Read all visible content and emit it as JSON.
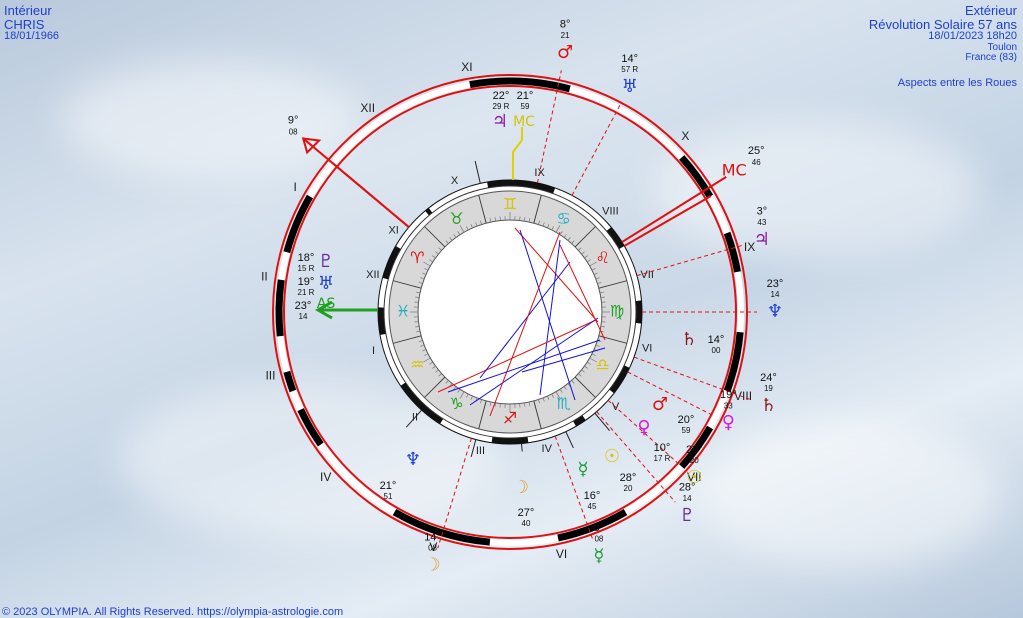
{
  "header_left": {
    "line1": "Intérieur",
    "line2": "CHRIS",
    "line3": "18/01/1966"
  },
  "header_right": {
    "line1": "Extérieur",
    "line2": "Révolution Solaire 57 ans",
    "line3": "18/01/2023 18h20",
    "line4": "Toulon",
    "line5": "France (83)"
  },
  "aspects_link": "Aspects entre les Roues",
  "footer": "© 2023 OLYMPIA. All Rights Reserved. https://olympia-astrologie.com",
  "colors": {
    "text": "#1f3fd0",
    "red": "#e01010",
    "blue": "#1010e0"
  },
  "outer_houses": [
    "XI",
    "XII",
    "I",
    "II",
    "III",
    "IV",
    "V",
    "VI",
    "VII",
    "VIII",
    "IX",
    "X"
  ],
  "inner_houses": [
    "X",
    "XI",
    "XII",
    "I",
    "II",
    "III",
    "IV",
    "V",
    "VI",
    "VII",
    "VIII",
    "IX"
  ],
  "outer_planets": [
    {
      "glyph": "♂",
      "deg": "8°",
      "min": "21",
      "color": "#e01010"
    },
    {
      "glyph": "♅",
      "deg": "14°",
      "min": "57 R",
      "color": "#1f3fd0"
    },
    {
      "glyph": "♃",
      "deg": "3°",
      "min": "43",
      "color": "#8a1aa8"
    },
    {
      "glyph": "♆",
      "deg": "23°",
      "min": "14",
      "color": "#1f3fd0"
    },
    {
      "glyph": "♄",
      "deg": "24°",
      "min": "19",
      "color": "#8a1a1a"
    },
    {
      "glyph": "♀",
      "deg": "19°",
      "min": "33",
      "color": "#d61ad6"
    },
    {
      "glyph": "☉",
      "deg": "28°",
      "min": "20",
      "color": "#d6c400"
    },
    {
      "glyph": "♇",
      "deg": "28°",
      "min": "14",
      "color": "#6a2a9a"
    },
    {
      "glyph": "☿",
      "deg": "8°",
      "min": "08",
      "color": "#1a9a3a"
    },
    {
      "glyph": "☽",
      "deg": "14°",
      "min": "08",
      "color": "#e0a030"
    }
  ],
  "outer_angles": [
    {
      "name": "AS",
      "deg": "9°",
      "min": "08"
    },
    {
      "name": "MC",
      "deg": "25°",
      "min": "46"
    }
  ],
  "inner_planets": [
    {
      "glyph": "♃",
      "deg": "22°",
      "min": "29 R",
      "color": "#8a1aa8"
    },
    {
      "glyph": "MC",
      "deg": "21°",
      "min": "59",
      "color": "#d6c400"
    },
    {
      "glyph": "♇",
      "deg": "18°",
      "min": "15 R",
      "color": "#6a2a9a"
    },
    {
      "glyph": "♅",
      "deg": "19°",
      "min": "21 R",
      "color": "#1f3fd0"
    },
    {
      "glyph": "AS",
      "deg": "23°",
      "min": "14",
      "color": "#20a020"
    },
    {
      "glyph": "♄",
      "deg": "14°",
      "min": "00",
      "color": "#8a1a1a"
    },
    {
      "glyph": "♂",
      "deg": "20°",
      "min": "59",
      "color": "#e01010"
    },
    {
      "glyph": "♀",
      "deg": "10°",
      "min": "17 R",
      "color": "#d61ad6"
    },
    {
      "glyph": "☉",
      "deg": "28°",
      "min": "20",
      "color": "#d6c400"
    },
    {
      "glyph": "☿",
      "deg": "16°",
      "min": "45",
      "color": "#1a9a3a"
    },
    {
      "glyph": "☽",
      "deg": "27°",
      "min": "40",
      "color": "#e0a030"
    },
    {
      "glyph": "♆",
      "deg": "21°",
      "min": "51",
      "color": "#1f3fd0"
    }
  ],
  "zodiac": [
    {
      "glyph": "♊",
      "color": "#d6c400"
    },
    {
      "glyph": "♋",
      "color": "#20b0c0"
    },
    {
      "glyph": "♌",
      "color": "#e01010"
    },
    {
      "glyph": "♍",
      "color": "#20a020"
    },
    {
      "glyph": "♎",
      "color": "#d6c400"
    },
    {
      "glyph": "♏",
      "color": "#20b0c0"
    },
    {
      "glyph": "♐",
      "color": "#e01010"
    },
    {
      "glyph": "♑",
      "color": "#20a020"
    },
    {
      "glyph": "♒",
      "color": "#d6c400"
    },
    {
      "glyph": "♓",
      "color": "#20b0c0"
    },
    {
      "glyph": "♈",
      "color": "#e01010"
    },
    {
      "glyph": "♉",
      "color": "#20a020"
    }
  ]
}
